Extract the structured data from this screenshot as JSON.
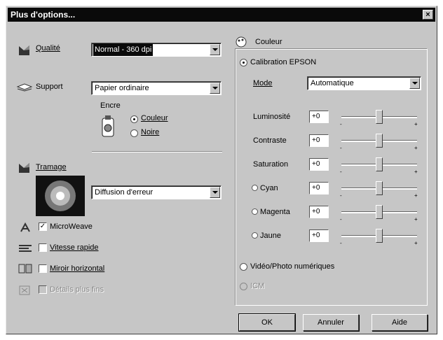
{
  "window": {
    "title": "Plus d'options...",
    "close_glyph": "×"
  },
  "left": {
    "quality_label": "Qualité",
    "quality_value": "Normal - 360 dpi",
    "support_label": "Support",
    "support_value": "Papier ordinaire",
    "ink_label": "Encre",
    "ink_color": "Couleur",
    "ink_black": "Noire",
    "halftoning_label": "Tramage",
    "halftoning_value": "Diffusion d'erreur",
    "microweave": "MicroWeave",
    "high_speed": "Vitesse rapide",
    "flip_horizontal": "Miroir horizontal",
    "finest_detail": "Détails plus fins"
  },
  "color_panel": {
    "title": "Couleur",
    "epson_calibration": "Calibration EPSON",
    "mode_label": "Mode",
    "mode_value": "Automatique",
    "adjustments": [
      {
        "label": "Luminosité",
        "value": "+0",
        "level": 0.5
      },
      {
        "label": "Contraste",
        "value": "+0",
        "level": 0.5
      },
      {
        "label": "Saturation",
        "value": "+0",
        "level": 0.5
      },
      {
        "label": "Cyan",
        "value": "+0",
        "level": 0.5
      },
      {
        "label": "Magenta",
        "value": "+0",
        "level": 0.5
      },
      {
        "label": "Jaune",
        "value": "+0",
        "level": 0.5
      }
    ],
    "tick_minus": "-",
    "tick_plus": "+",
    "video_photo": "Vidéo/Photo numériques",
    "icm": "ICM"
  },
  "buttons": {
    "ok": "OK",
    "cancel": "Annuler",
    "help": "Aide"
  }
}
